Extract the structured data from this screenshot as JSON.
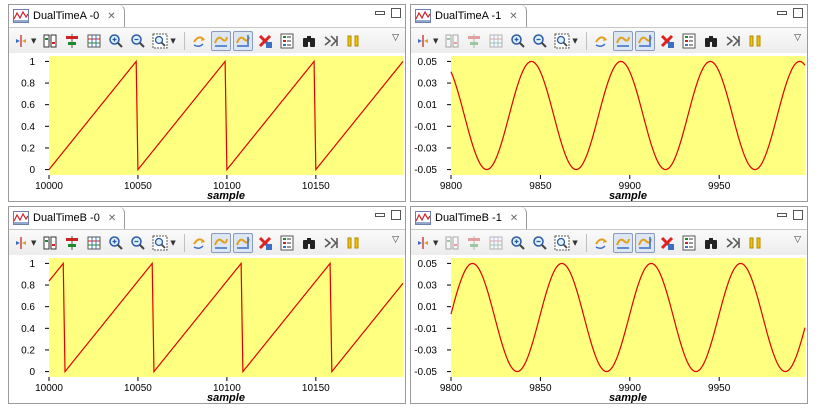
{
  "colors": {
    "plot_background": "#ffff80",
    "trace": "#e00000",
    "frame": "#9a9a9a"
  },
  "views": [
    {
      "tab_label": "DualTimeA -0",
      "tab_icon": "waveform-view-icon",
      "close_icon": "close-icon",
      "toolbar_state": "enabled"
    },
    {
      "tab_label": "DualTimeA -1",
      "tab_icon": "waveform-view-icon",
      "close_icon": "close-icon",
      "toolbar_state": "partially-disabled"
    },
    {
      "tab_label": "DualTimeB -0",
      "tab_icon": "waveform-view-icon",
      "close_icon": "close-icon",
      "toolbar_state": "enabled"
    },
    {
      "tab_label": "DualTimeB -1",
      "tab_icon": "waveform-view-icon",
      "close_icon": "close-icon",
      "toolbar_state": "partially-disabled"
    }
  ],
  "toolbar_icons": [
    "marker-dropdown-icon",
    "split-channels-icon",
    "align-icon",
    "grid-icon",
    "zoom-in-icon",
    "zoom-out-icon",
    "zoom-region-dropdown-icon",
    "pan-icon",
    "auto-scale-x-icon",
    "auto-scale-y-icon",
    "clear-icon",
    "properties-icon",
    "binoculars-icon",
    "step-icon",
    "pause-icon",
    "view-menu-icon"
  ],
  "chart_data": [
    {
      "type": "line",
      "xlabel": "sample",
      "xlim": [
        10000,
        10199
      ],
      "ylim": [
        -0.05,
        1.05
      ],
      "xticks": [
        "10000",
        "10050",
        "10100",
        "10150"
      ],
      "xtick_values": [
        10000,
        10050,
        10100,
        10150
      ],
      "yticks": [
        "0",
        "0.2",
        "0.4",
        "0.6",
        "0.8",
        "1"
      ],
      "ytick_values": [
        0,
        0.2,
        0.4,
        0.6,
        0.8,
        1
      ],
      "waveform": "sawtooth",
      "period": 50,
      "phase_sample": 10000,
      "amplitude_min": 0,
      "amplitude_max": 1
    },
    {
      "type": "line",
      "xlabel": "sample",
      "xlim": [
        9800,
        9998
      ],
      "ylim": [
        -0.055,
        0.055
      ],
      "xticks": [
        "9800",
        "9850",
        "9900",
        "9950"
      ],
      "xtick_values": [
        9800,
        9850,
        9900,
        9950
      ],
      "yticks": [
        "0.05",
        "0.03",
        "0.01",
        "-0.01",
        "-0.03",
        "-0.05"
      ],
      "ytick_values": [
        0.05,
        0.03,
        0.01,
        -0.01,
        -0.03,
        -0.05
      ],
      "waveform": "sine",
      "period": 50,
      "amplitude": 0.05,
      "peak_sample": 9845
    },
    {
      "type": "line",
      "xlabel": "sample",
      "xlim": [
        10000,
        10199
      ],
      "ylim": [
        -0.05,
        1.05
      ],
      "xticks": [
        "10000",
        "10050",
        "10100",
        "10150"
      ],
      "xtick_values": [
        10000,
        10050,
        10100,
        10150
      ],
      "yticks": [
        "0",
        "0.2",
        "0.4",
        "0.6",
        "0.8",
        "1"
      ],
      "ytick_values": [
        0,
        0.2,
        0.4,
        0.6,
        0.8,
        1
      ],
      "waveform": "sawtooth",
      "period": 50,
      "phase_sample": 10009,
      "amplitude_min": 0,
      "amplitude_max": 1
    },
    {
      "type": "line",
      "xlabel": "sample",
      "xlim": [
        9800,
        9998
      ],
      "ylim": [
        -0.055,
        0.055
      ],
      "xticks": [
        "9800",
        "9850",
        "9900",
        "9950"
      ],
      "xtick_values": [
        9800,
        9850,
        9900,
        9950
      ],
      "yticks": [
        "0.05",
        "0.03",
        "0.01",
        "-0.01",
        "-0.03",
        "-0.05"
      ],
      "ytick_values": [
        0.05,
        0.03,
        0.01,
        -0.01,
        -0.03,
        -0.05
      ],
      "waveform": "sine",
      "period": 50,
      "amplitude": 0.05,
      "peak_sample": 9812
    }
  ]
}
